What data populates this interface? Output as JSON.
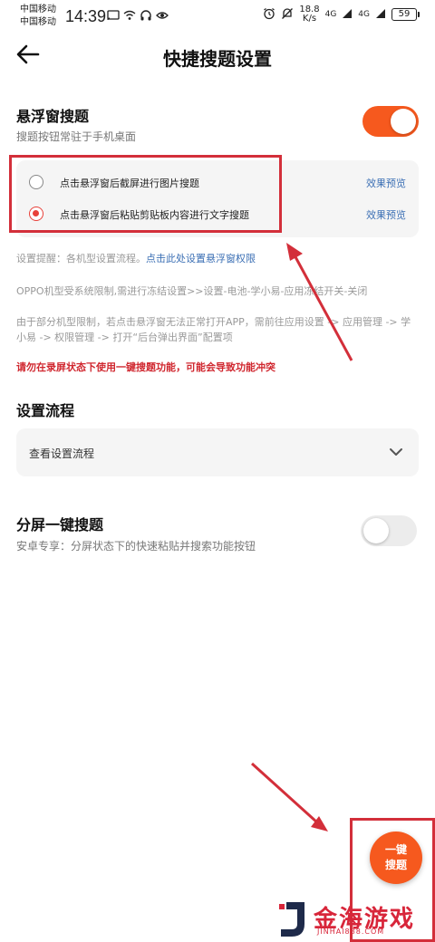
{
  "status_bar": {
    "carrier_1": "中国移动",
    "carrier_2": "中国移动",
    "time": "14:39",
    "left_icons": [
      "cast-icon",
      "wifi-icon",
      "headphones-icon",
      "eye-icon"
    ],
    "right_icons": [
      "alarm-icon",
      "silent-icon"
    ],
    "speed_value": "18.8",
    "speed_unit": "K/s",
    "net_1": "4G",
    "net_2": "4G",
    "battery": "59"
  },
  "header": {
    "title": "快捷搜题设置",
    "back_icon": "arrow-left-icon"
  },
  "floating_section": {
    "title": "悬浮窗搜题",
    "subtitle": "搜题按钮常驻于手机桌面",
    "enabled": true,
    "options": [
      {
        "label": "点击悬浮窗后截屏进行图片搜题",
        "selected": false,
        "preview": "效果预览"
      },
      {
        "label": "点击悬浮窗后粘贴剪贴板内容进行文字搜题",
        "selected": true,
        "preview": "效果预览"
      }
    ]
  },
  "notes": {
    "tip_prefix": "设置提醒：各机型设置流程。",
    "tip_link": "点击此处设置悬浮窗权限",
    "oppo": "OPPO机型受系统限制,需进行冻结设置>>设置-电池-学小易-应用冻结开关-关闭",
    "limit": "由于部分机型限制，若点击悬浮窗无法正常打开APP，需前往应用设置 -> 应用管理 -> 学小易 -> 权限管理 -> 打开“后台弹出界面”配置项",
    "warning": "请勿在录屏状态下使用一键搜题功能，可能会导致功能冲突"
  },
  "flow_section": {
    "title": "设置流程",
    "card_label": "查看设置流程",
    "chevron_icon": "chevron-down-icon"
  },
  "split_section": {
    "title": "分屏一键搜题",
    "subtitle": "安卓专享：分屏状态下的快速粘贴并搜索功能按钮",
    "enabled": false
  },
  "fab": {
    "line_1": "一键",
    "line_2": "搜题"
  },
  "watermark": {
    "text": "金海游戏",
    "sub": "JINHAI888.COM"
  },
  "colors": {
    "accent": "#f6591e",
    "annotation_red": "#d32f3a",
    "link_blue": "#3b6fb4",
    "warning_red": "#d0272f"
  }
}
